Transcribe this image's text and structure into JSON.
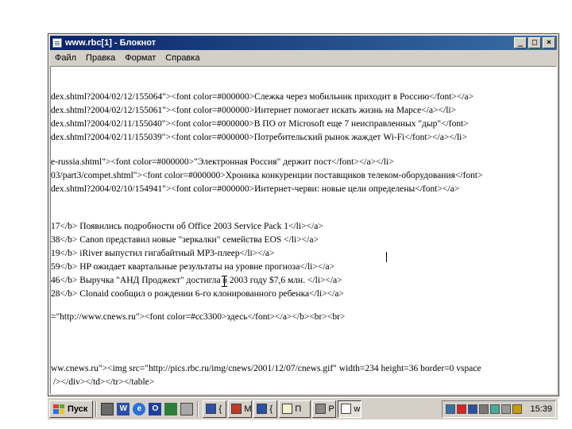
{
  "window": {
    "title": "www.rbc[1] - Блокнот",
    "minimize_glyph": "_",
    "maximize_glyph": "□",
    "close_glyph": "×"
  },
  "menu": [
    "Файл",
    "Правка",
    "Формат",
    "Справка"
  ],
  "editor": {
    "lines": [
      "dex.shtml?2004/02/12/155064\"><font color=#000000>Слежка через мобильник приходит в Россию</font></a>",
      "dex.shtml?2004/02/12/155061\"><font color=#000000>Интернет помогает искать жизнь на Марсе</a></li>",
      "dex.shtml?2004/02/11/155040\"><font color=#000000>В ПО от Microsoft еще 7 неисправленных \"дыр\"</font>",
      "dex.shtml?2004/02/11/155039\"><font color=#000000>Потребительский рынок жаждет Wi-Fi</font></a></li>",
      "e-russia.shtml\"><font color=#000000>\"Электронная Россия\" держит пост</font></a></li>",
      "03/part3/compet.shtml\"><font color=#000000>Хроника конкуренции поставщиков телеком-оборудования</font>",
      "dex.shtml?2004/02/10/154941\"><font color=#000000>Интернет-черви: новые цели определены</font></a>",
      "17</b> Появились подробности об Office 2003 Service Pack 1</li></a>",
      "38</b> Canon представил новые \"зеркалки\" семейства EOS </li></a>",
      "19</b> iRiver выпустил гигабайтный MP3-плеер</li></a>",
      "59</b> HP ожидает квартальные результаты на уровне прогноза</li></a>",
      "46</b> Выручка \"АНД Проджект\" достигла в 2003 году $7,6 млн. </li></a>",
      "28</b> Clonaid сообщил о рождении 6-го клонированного ребенка</li></a>",
      "=\"http://www.cnews.ru\"><font color=#cc3300>здесь</font></a></b><br><br>",
      "ww.cnews.ru\"><img src=\"http://pics.rbc.ru/img/cnews/2001/12/07/cnews.gif\" width=234 height=36 border=0 vspace",
      " /></div></td></tr></table>"
    ]
  },
  "taskbar": {
    "start_label": "Пуск",
    "quick_launch": [
      "W",
      "e",
      "O"
    ],
    "tasks": [
      "{",
      "M",
      "{",
      "П",
      "P",
      "w"
    ],
    "clock": "15:39"
  }
}
